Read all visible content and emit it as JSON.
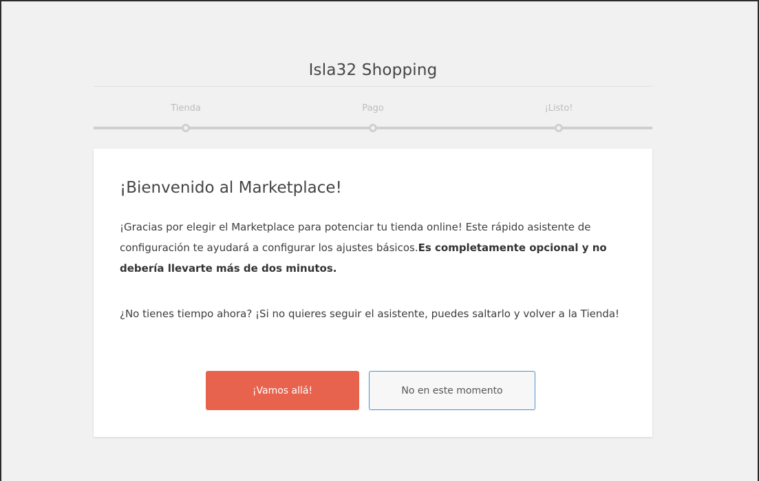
{
  "header": {
    "title": "Isla32 Shopping"
  },
  "steps": [
    {
      "label": "Tienda"
    },
    {
      "label": "Pago"
    },
    {
      "label": "¡Listo!"
    }
  ],
  "card": {
    "title": "¡Bienvenido al Marketplace!",
    "intro_text": "¡Gracias por elegir el Marketplace para potenciar tu tienda online! Este rápido asistente de configuración te ayudará a configurar los ajustes básicos.",
    "intro_bold": "Es completamente opcional y no debería llevarte más de dos minutos.",
    "skip_text": "¿No tienes tiempo ahora? ¡Si no quieres seguir el asistente, puedes saltarlo y volver a la Tienda!"
  },
  "buttons": {
    "primary_label": "¡Vamos allá!",
    "secondary_label": "No en este momento"
  },
  "colors": {
    "primary_button": "#e8634e",
    "secondary_button_border": "#4b8fcf",
    "background": "#f1f1f1"
  }
}
